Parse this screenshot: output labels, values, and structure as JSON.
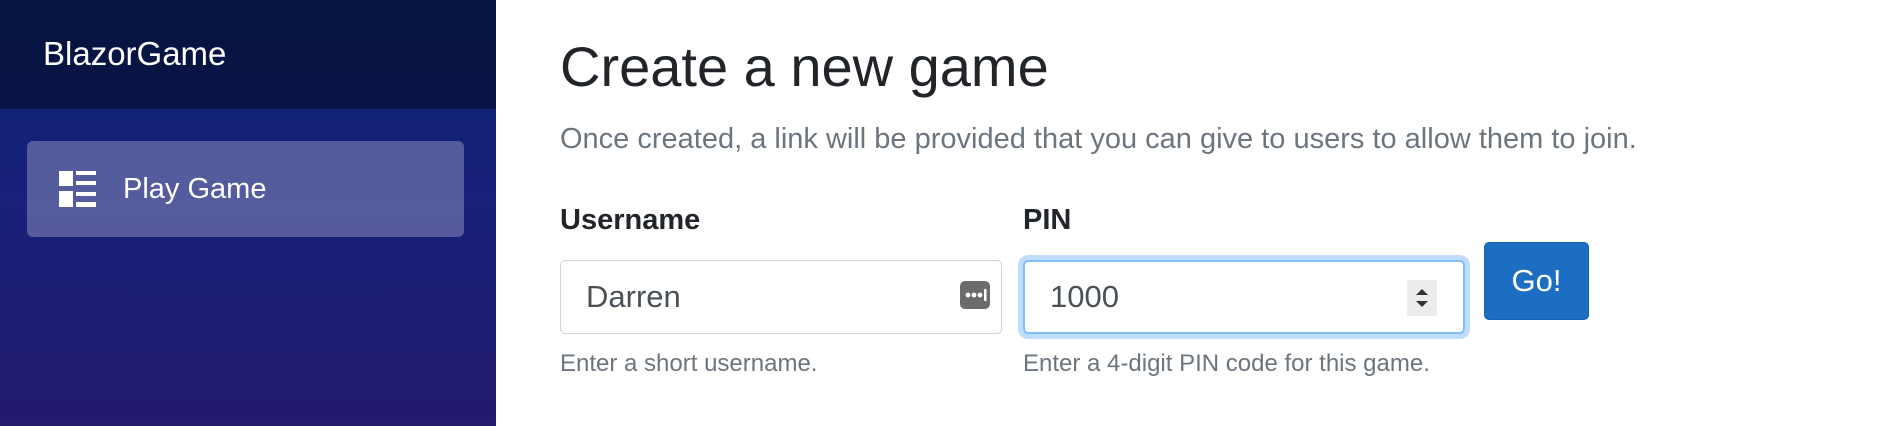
{
  "sidebar": {
    "brand": "BlazorGame",
    "nav_items": [
      {
        "label": "Play Game",
        "icon": "list-icon",
        "active": true
      }
    ]
  },
  "main": {
    "title": "Create a new game",
    "lead": "Once created, a link will be provided that you can give to users to allow them to join.",
    "username": {
      "label": "Username",
      "value": "Darren",
      "help": "Enter a short username."
    },
    "pin": {
      "label": "PIN",
      "value": "1000",
      "help": "Enter a 4-digit PIN code for this game."
    },
    "go_button": "Go!"
  },
  "colors": {
    "sidebar_top": "#0a2470",
    "sidebar_bottom": "#221a6b",
    "button": "#1b6ec2",
    "focus_ring": "#80bdff"
  }
}
